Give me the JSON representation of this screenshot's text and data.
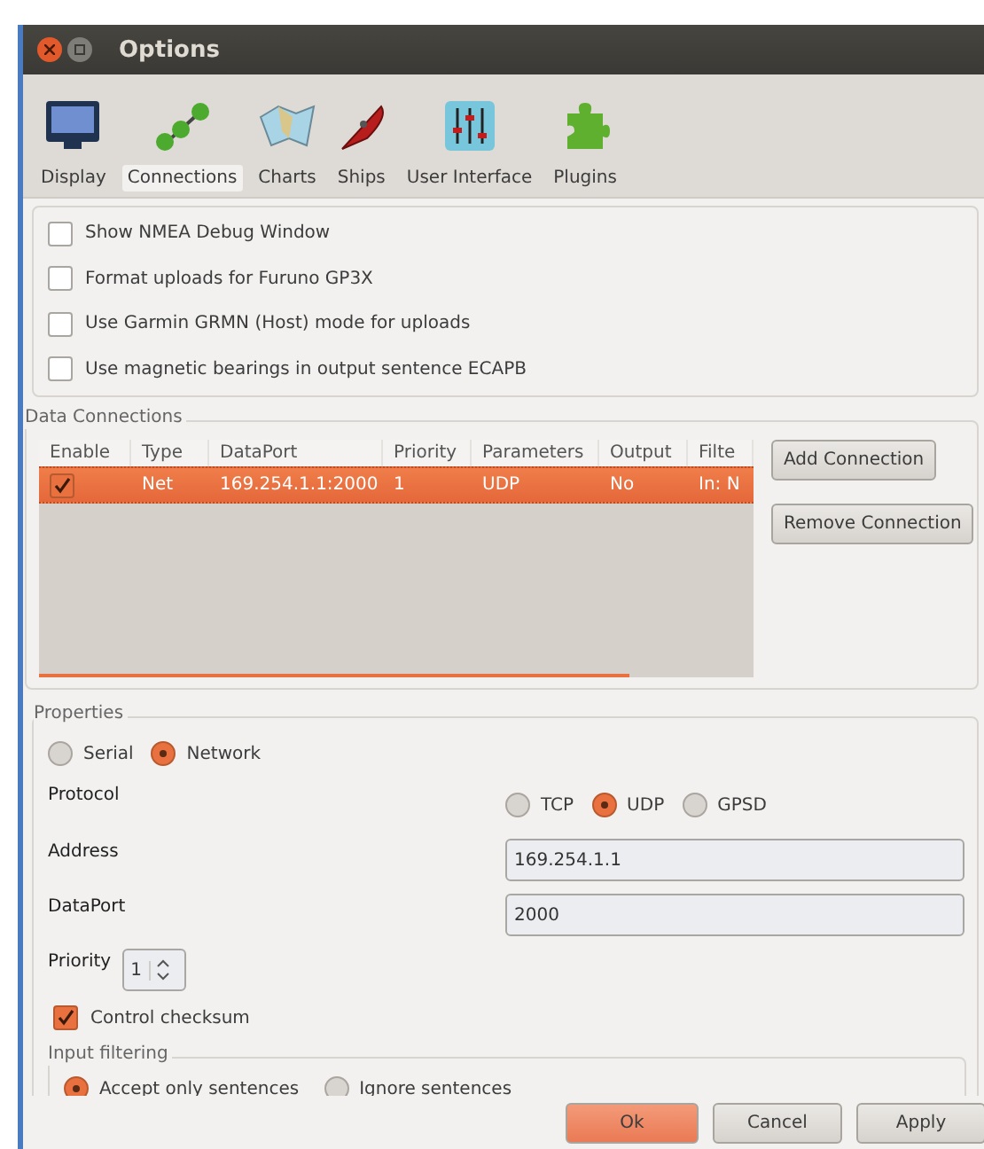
{
  "window": {
    "title": "Options"
  },
  "toolbar": {
    "tabs": [
      {
        "label": "Display",
        "selected": false
      },
      {
        "label": "Connections",
        "selected": true
      },
      {
        "label": "Charts",
        "selected": false
      },
      {
        "label": "Ships",
        "selected": false
      },
      {
        "label": "User Interface",
        "selected": false
      },
      {
        "label": "Plugins",
        "selected": false
      }
    ]
  },
  "options": [
    {
      "label": "Show NMEA Debug Window",
      "checked": false
    },
    {
      "label": "Format uploads for Furuno GP3X",
      "checked": false
    },
    {
      "label": "Use Garmin GRMN (Host) mode for uploads",
      "checked": false
    },
    {
      "label": "Use magnetic bearings in output sentence ECAPB",
      "checked": false
    }
  ],
  "data_connections": {
    "title": "Data Connections",
    "columns": [
      "Enable",
      "Type",
      "DataPort",
      "Priority",
      "Parameters",
      "Output",
      "Filte"
    ],
    "rows": [
      {
        "enabled": true,
        "selected": true,
        "cells": [
          "",
          "Net",
          "169.254.1.1:2000",
          "1",
          "UDP",
          "No",
          "In: N"
        ]
      }
    ],
    "buttons": [
      "Add Connection",
      "Remove Connection"
    ]
  },
  "properties": {
    "title": "Properties",
    "modes": [
      {
        "label": "Serial",
        "selected": false
      },
      {
        "label": "Network",
        "selected": true
      }
    ],
    "protocol": {
      "label": "Protocol",
      "options": [
        {
          "label": "TCP",
          "selected": false
        },
        {
          "label": "UDP",
          "selected": true
        },
        {
          "label": "GPSD",
          "selected": false
        }
      ]
    },
    "address": {
      "label": "Address",
      "value": "169.254.1.1"
    },
    "dataport": {
      "label": "DataPort",
      "value": "2000"
    },
    "priority": {
      "label": "Priority",
      "value": "1"
    },
    "control_checksum": {
      "label": "Control checksum",
      "checked": true
    },
    "input_filtering": {
      "title": "Input filtering",
      "options": [
        {
          "label": "Accept only sentences",
          "selected": true
        },
        {
          "label": "Ignore sentences",
          "selected": false
        }
      ]
    }
  },
  "buttons": [
    {
      "label": "Ok",
      "kind": "default"
    },
    {
      "label": "Cancel",
      "kind": "normal"
    },
    {
      "label": "Apply",
      "kind": "normal"
    }
  ]
}
